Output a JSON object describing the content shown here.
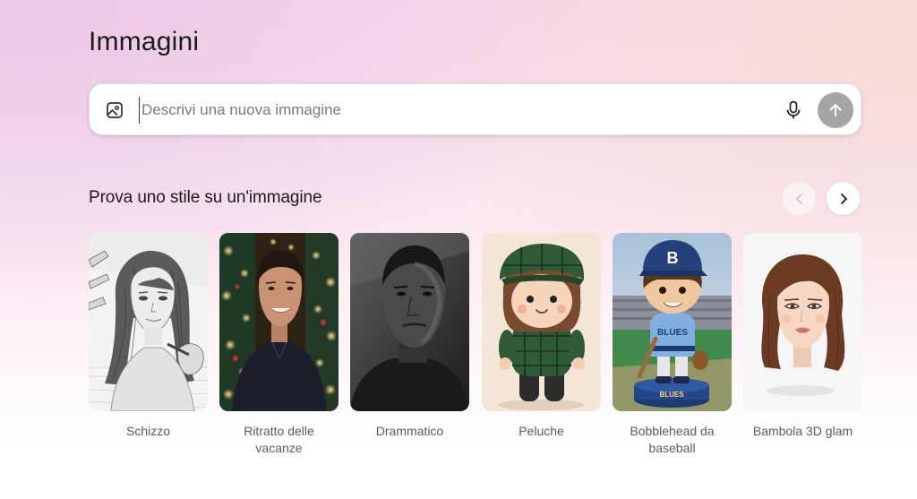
{
  "page": {
    "title": "Immagini"
  },
  "prompt": {
    "placeholder": "Descrivi una nuova immagine",
    "value": "",
    "image_icon": "image-upload-icon",
    "mic_icon": "microphone-icon",
    "send_icon": "arrow-up-icon"
  },
  "styles_section": {
    "title": "Prova uno stile su un'immagine",
    "prev_icon": "chevron-left-icon",
    "next_icon": "chevron-right-icon",
    "items": [
      {
        "label": "Schizzo"
      },
      {
        "label": "Ritratto delle vacanze"
      },
      {
        "label": "Drammatico"
      },
      {
        "label": "Peluche"
      },
      {
        "label": "Bobblehead da baseball"
      },
      {
        "label": "Bambola 3D glam"
      }
    ]
  },
  "bobblehead_base_text": "BLUES",
  "bobblehead_cap_letter": "B",
  "bobblehead_shirt_text": "BLUES",
  "colors": {
    "send_button": "#a5a5a5",
    "background_top": "#f6d6ec"
  }
}
